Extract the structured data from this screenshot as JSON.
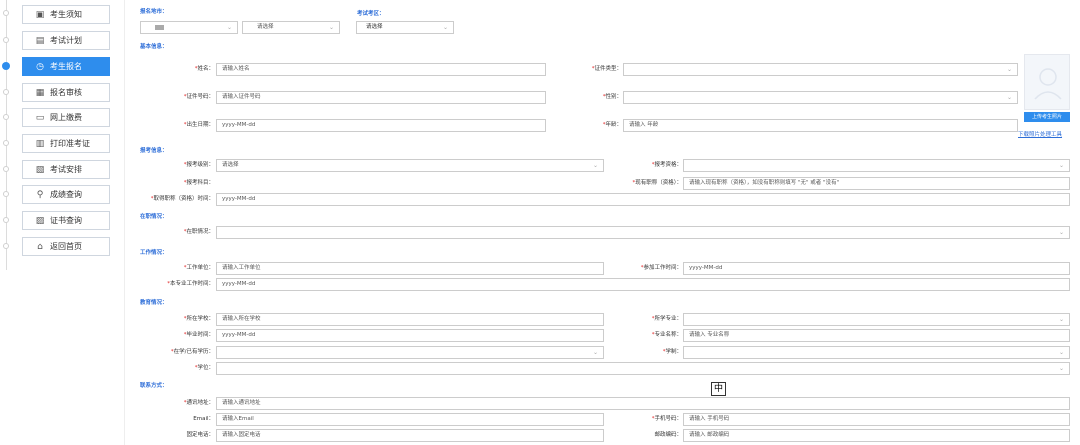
{
  "sidebar": {
    "items": [
      {
        "label": "考生须知",
        "icon": "notice-icon"
      },
      {
        "label": "考试计划",
        "icon": "calendar-icon"
      },
      {
        "label": "考生报名",
        "icon": "clock-icon",
        "active": true
      },
      {
        "label": "报名审核",
        "icon": "audit-icon"
      },
      {
        "label": "网上缴费",
        "icon": "monitor-icon"
      },
      {
        "label": "打印准考证",
        "icon": "printer-icon"
      },
      {
        "label": "考试安排",
        "icon": "schedule-icon"
      },
      {
        "label": "成绩查询",
        "icon": "search-icon"
      },
      {
        "label": "证书查询",
        "icon": "certificate-icon"
      },
      {
        "label": "返回首页",
        "icon": "home-icon"
      }
    ]
  },
  "top": {
    "city_label": "报名地市：",
    "city_select_placeholder": "请选择",
    "exam_area_label": "考试考区：",
    "exam_area_placeholder": "请选择"
  },
  "sections": {
    "basic": "基本信息：",
    "report": "报考信息：",
    "job": "在职情况：",
    "work": "工作情况：",
    "edu": "教育情况：",
    "contact": "联系方式："
  },
  "basic": {
    "name_label": "姓名：",
    "name_placeholder": "请输入姓名",
    "idtype_label": "证件类型：",
    "idno_label": "证件号码：",
    "idno_placeholder": "请输入证件号码",
    "gender_label": "性别：",
    "birth_label": "出生日期：",
    "birth_placeholder": "yyyy-MM-dd",
    "age_label": "年龄：",
    "age_placeholder": "请输入 年龄",
    "upload_button": "上传考生照片",
    "download_link": "下载照片处理工具"
  },
  "report": {
    "level_label": "报考级别：",
    "level_placeholder": "请选择",
    "qual_label": "报考资格：",
    "subject_label": "报考科目：",
    "title_label": "现有职称（资格）：",
    "title_placeholder": "请输入现有职称（资格），如没有职称则填写 \"无\" 或者 \"没有\"",
    "title_time_label": "取得职称（资格）时间：",
    "title_time_placeholder": "yyyy-MM-dd"
  },
  "job": {
    "status_label": "在职情况："
  },
  "work": {
    "unit_label": "工作单位：",
    "unit_placeholder": "请输入工作单位",
    "start_label": "参加工作时间：",
    "start_placeholder": "yyyy-MM-dd",
    "major_time_label": "本专业工作时间：",
    "major_time_placeholder": "yyyy-MM-dd"
  },
  "edu": {
    "school_label": "所在学校：",
    "school_placeholder": "请输入所在学校",
    "major_label": "所学专业：",
    "grad_label": "毕业时间：",
    "grad_placeholder": "yyyy-MM-dd",
    "major_name_label": "专业名称：",
    "major_name_placeholder": "请输入 专业名称",
    "degree_edu_label": "在学/已有学历：",
    "system_label": "学制：",
    "degree_label": "学位："
  },
  "contact": {
    "addr_label": "通讯地址：",
    "addr_placeholder": "请输入通讯地址",
    "email_label": "Email：",
    "email_placeholder": "请输入Email",
    "mobile_label": "手机号码：",
    "mobile_placeholder": "请输入 手机号码",
    "phone_label": "固定电话：",
    "phone_placeholder": "请输入固定电话",
    "zip_label": "邮政编码：",
    "zip_placeholder": "请输入 邮政编码"
  },
  "ime": "中",
  "colors": {
    "accent": "#2e8ded",
    "section": "#2e6ed8",
    "required": "#e02020"
  }
}
